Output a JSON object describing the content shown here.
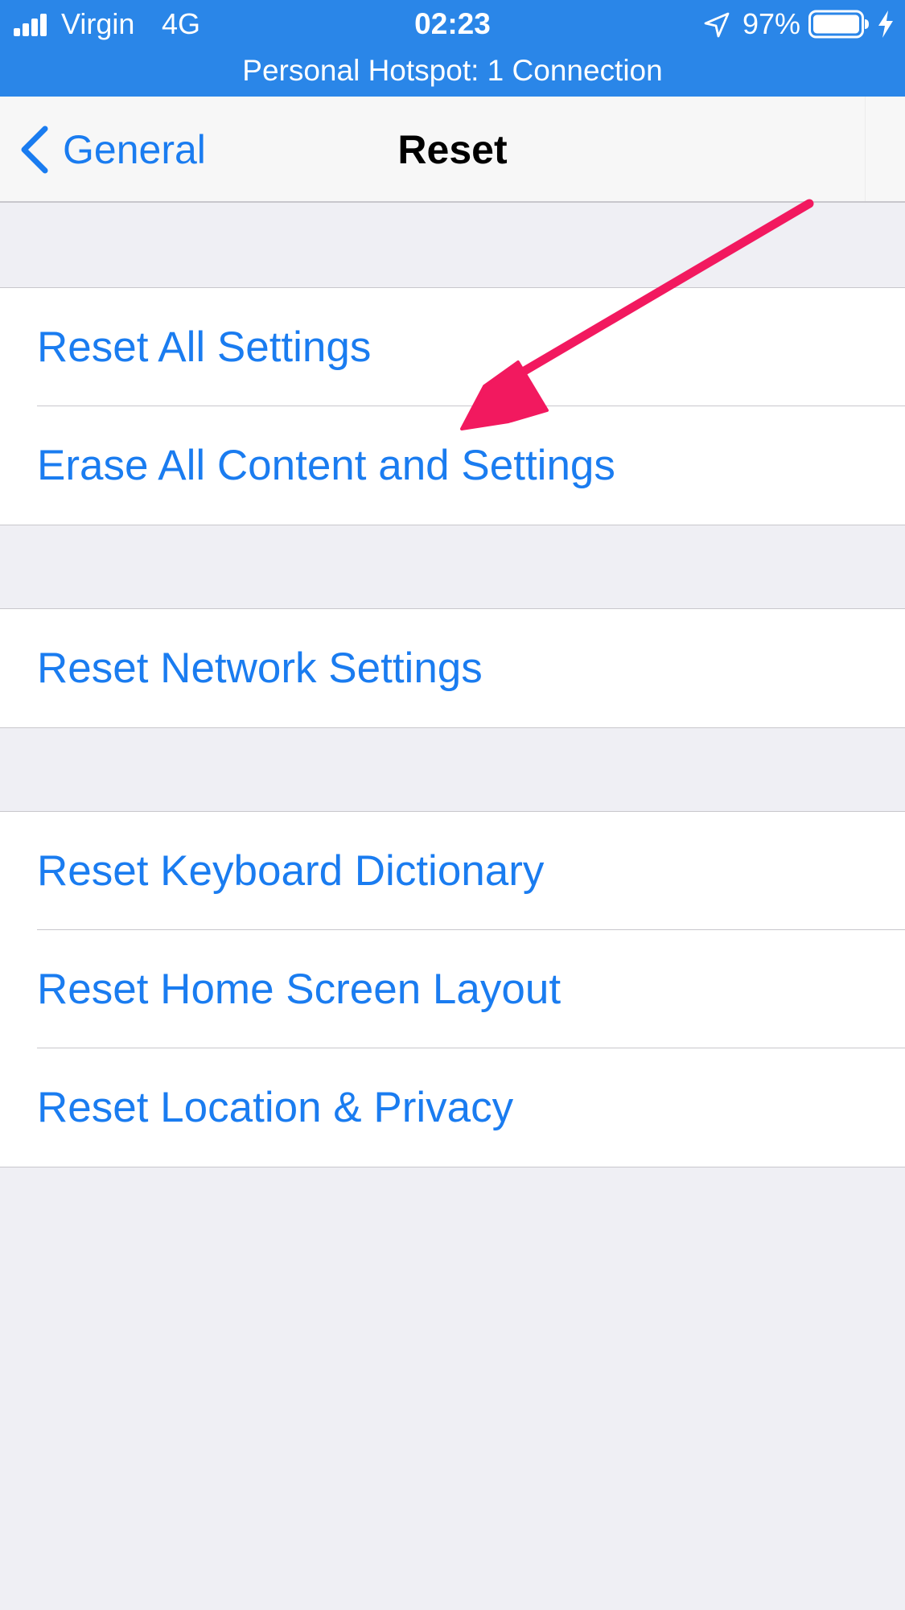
{
  "status_bar": {
    "carrier": "Virgin",
    "network": "4G",
    "time": "02:23",
    "battery_percent": "97%",
    "hotspot": "Personal Hotspot: 1 Connection",
    "background_color": "#2a86e8"
  },
  "nav": {
    "back_label": "General",
    "title": "Reset"
  },
  "groups": [
    {
      "rows": [
        {
          "label": "Reset All Settings"
        },
        {
          "label": "Erase All Content and Settings"
        }
      ]
    },
    {
      "rows": [
        {
          "label": "Reset Network Settings"
        }
      ]
    },
    {
      "rows": [
        {
          "label": "Reset Keyboard Dictionary"
        },
        {
          "label": "Reset Home Screen Layout"
        },
        {
          "label": "Reset Location & Privacy"
        }
      ]
    }
  ],
  "colors": {
    "link_blue": "#1a7cf0",
    "grouped_background": "#efeff4",
    "annotation_arrow": "#f2195f"
  },
  "icons": {
    "signal": "signal-strength-icon",
    "location": "location-arrow-icon",
    "battery": "battery-icon",
    "charging": "charging-bolt-icon",
    "back": "chevron-left-icon",
    "annotation": "annotation-arrow"
  }
}
